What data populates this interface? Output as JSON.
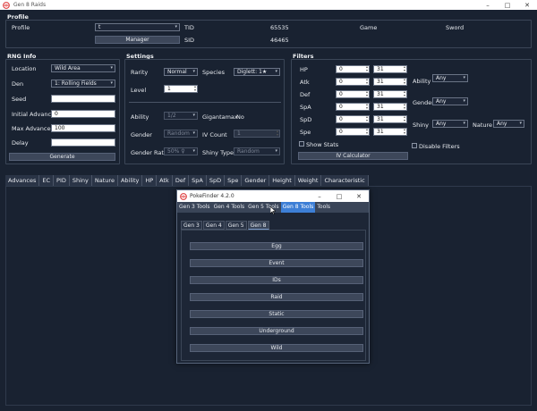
{
  "window": {
    "title": "Gen 8 Raids",
    "min": "–",
    "max": "□",
    "close": "✕"
  },
  "profile": {
    "title": "Profile",
    "profile_label": "Profile",
    "profile_value": "t",
    "manager_label": "Manager",
    "tid_label": "TID",
    "tid_value": "65535",
    "sid_label": "SID",
    "sid_value": "46465",
    "game_label": "Game",
    "game_value": "Sword"
  },
  "rng": {
    "title": "RNG Info",
    "location_label": "Location",
    "location_value": "Wild Area",
    "den_label": "Den",
    "den_value": "1: Rolling Fields",
    "seed_label": "Seed",
    "seed_value": "",
    "initial_label": "Initial Advances",
    "initial_value": "0",
    "max_label": "Max Advances",
    "max_value": "100",
    "delay_label": "Delay",
    "delay_value": "",
    "generate_label": "Generate"
  },
  "settings": {
    "title": "Settings",
    "rarity_label": "Rarity",
    "rarity_value": "Normal",
    "species_label": "Species",
    "species_value": "Diglett: 1★",
    "level_label": "Level",
    "level_value": "1",
    "ability_label": "Ability",
    "ability_value": "1/2",
    "gmax_label": "Gigantamax",
    "gmax_value": "No",
    "gender_label": "Gender",
    "gender_value": "Random",
    "ivcount_label": "IV Count",
    "ivcount_value": "1",
    "ratio_label": "Gender Ratio",
    "ratio_value": "50% ♀",
    "shinytype_label": "Shiny Type",
    "shinytype_value": "Random"
  },
  "filters": {
    "title": "Filters",
    "stats": [
      {
        "label": "HP",
        "min": "0",
        "max": "31"
      },
      {
        "label": "Atk",
        "min": "0",
        "max": "31"
      },
      {
        "label": "Def",
        "min": "0",
        "max": "31"
      },
      {
        "label": "SpA",
        "min": "0",
        "max": "31"
      },
      {
        "label": "SpD",
        "min": "0",
        "max": "31"
      },
      {
        "label": "Spe",
        "min": "0",
        "max": "31"
      }
    ],
    "ability_label": "Ability",
    "ability_value": "Any",
    "gender_label": "Gender",
    "gender_value": "Any",
    "shiny_label": "Shiny",
    "shiny_value": "Any",
    "nature_label": "Nature",
    "nature_value": "Any",
    "show_stats_label": "Show Stats",
    "disable_filters_label": "Disable Filters",
    "iv_calc_label": "IV Calculator"
  },
  "table": {
    "columns": [
      "Advances",
      "EC",
      "PID",
      "Shiny",
      "Nature",
      "Ability",
      "HP",
      "Atk",
      "Def",
      "SpA",
      "SpD",
      "Spe",
      "Gender",
      "Height",
      "Weight",
      "Characteristic"
    ]
  },
  "popup": {
    "title": "PokeFinder 4.2.0",
    "menu": [
      "Gen 3 Tools",
      "Gen 4 Tools",
      "Gen 5 Tools",
      "Gen 8 Tools",
      "Tools"
    ],
    "tabs": [
      "Gen 3",
      "Gen 4",
      "Gen 5",
      "Gen 8"
    ],
    "buttons": [
      "Egg",
      "Event",
      "IDs",
      "Raid",
      "Static",
      "Underground",
      "Wild"
    ]
  }
}
